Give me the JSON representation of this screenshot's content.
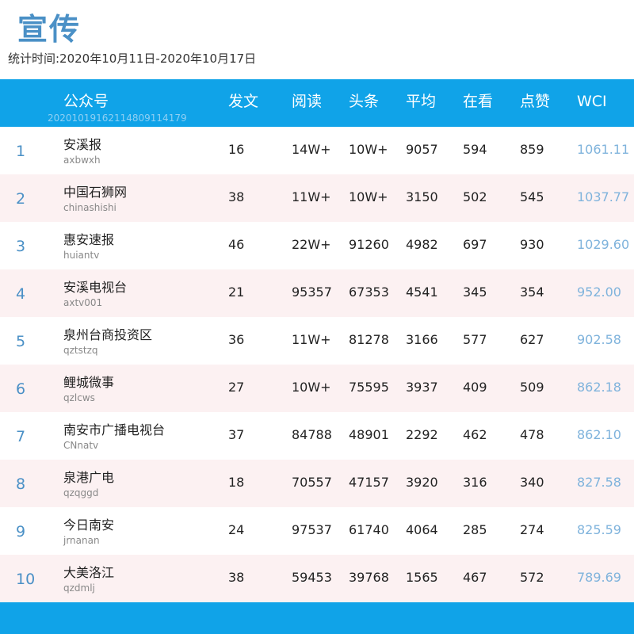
{
  "title": "宣传",
  "period": "统计时间:2020年10月11日-2020年10月17日",
  "header": {
    "account": "公众号",
    "posts": "发文",
    "reads": "阅读",
    "headline": "头条",
    "average": "平均",
    "watching": "在看",
    "likes": "点赞",
    "wci": "WCI",
    "stamp": "20201019162114809114179"
  },
  "rows": [
    {
      "rank": "1",
      "name": "安溪报",
      "id": "axbwxh",
      "posts": "16",
      "reads": "14W+",
      "headline": "10W+",
      "average": "9057",
      "watching": "594",
      "likes": "859",
      "wci": "1061.11"
    },
    {
      "rank": "2",
      "name": "中国石狮网",
      "id": "chinashishi",
      "posts": "38",
      "reads": "11W+",
      "headline": "10W+",
      "average": "3150",
      "watching": "502",
      "likes": "545",
      "wci": "1037.77"
    },
    {
      "rank": "3",
      "name": "惠安速报",
      "id": "huiantv",
      "posts": "46",
      "reads": "22W+",
      "headline": "91260",
      "average": "4982",
      "watching": "697",
      "likes": "930",
      "wci": "1029.60"
    },
    {
      "rank": "4",
      "name": "安溪电视台",
      "id": "axtv001",
      "posts": "21",
      "reads": "95357",
      "headline": "67353",
      "average": "4541",
      "watching": "345",
      "likes": "354",
      "wci": "952.00"
    },
    {
      "rank": "5",
      "name": "泉州台商投资区",
      "id": "qztstzq",
      "posts": "36",
      "reads": "11W+",
      "headline": "81278",
      "average": "3166",
      "watching": "577",
      "likes": "627",
      "wci": "902.58"
    },
    {
      "rank": "6",
      "name": "鲤城微事",
      "id": "qzlcws",
      "posts": "27",
      "reads": "10W+",
      "headline": "75595",
      "average": "3937",
      "watching": "409",
      "likes": "509",
      "wci": "862.18"
    },
    {
      "rank": "7",
      "name": "南安市广播电视台",
      "id": "CNnatv",
      "posts": "37",
      "reads": "84788",
      "headline": "48901",
      "average": "2292",
      "watching": "462",
      "likes": "478",
      "wci": "862.10"
    },
    {
      "rank": "8",
      "name": "泉港广电",
      "id": "qzqggd",
      "posts": "18",
      "reads": "70557",
      "headline": "47157",
      "average": "3920",
      "watching": "316",
      "likes": "340",
      "wci": "827.58"
    },
    {
      "rank": "9",
      "name": "今日南安",
      "id": "jrnanan",
      "posts": "24",
      "reads": "97537",
      "headline": "61740",
      "average": "4064",
      "watching": "285",
      "likes": "274",
      "wci": "825.59"
    },
    {
      "rank": "10",
      "name": "大美洛江",
      "id": "qzdmlj",
      "posts": "38",
      "reads": "59453",
      "headline": "39768",
      "average": "1565",
      "watching": "467",
      "likes": "572",
      "wci": "789.69"
    }
  ]
}
